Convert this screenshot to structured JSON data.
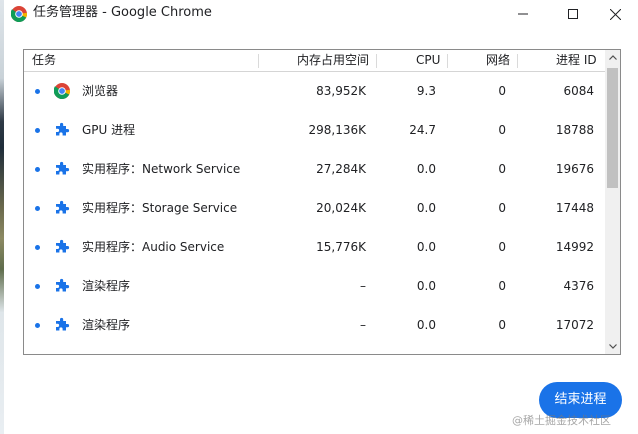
{
  "window": {
    "title": "任务管理器 - Google Chrome"
  },
  "table": {
    "headers": {
      "task": "任务",
      "memory": "内存占用空间",
      "cpu": "CPU",
      "network": "网络",
      "pid": "进程 ID"
    },
    "rows": [
      {
        "icon": "chrome-icon",
        "name": "浏览器",
        "memory": "83,952K",
        "cpu": "9.3",
        "network": "0",
        "pid": "6084"
      },
      {
        "icon": "puzzle-icon",
        "name": "GPU 进程",
        "memory": "298,136K",
        "cpu": "24.7",
        "network": "0",
        "pid": "18788"
      },
      {
        "icon": "puzzle-icon",
        "name": "实用程序：Network Service",
        "memory": "27,284K",
        "cpu": "0.0",
        "network": "0",
        "pid": "19676"
      },
      {
        "icon": "puzzle-icon",
        "name": "实用程序：Storage Service",
        "memory": "20,024K",
        "cpu": "0.0",
        "network": "0",
        "pid": "17448"
      },
      {
        "icon": "puzzle-icon",
        "name": "实用程序：Audio Service",
        "memory": "15,776K",
        "cpu": "0.0",
        "network": "0",
        "pid": "14992"
      },
      {
        "icon": "puzzle-icon",
        "name": "渲染程序",
        "memory": "–",
        "cpu": "0.0",
        "network": "0",
        "pid": "4376"
      },
      {
        "icon": "puzzle-icon",
        "name": "渲染程序",
        "memory": "–",
        "cpu": "0.0",
        "network": "0",
        "pid": "17072"
      }
    ]
  },
  "actions": {
    "end_process_label": "结束进程"
  },
  "watermark": {
    "text": "@稀土掘金技术社区"
  },
  "colors": {
    "accent": "#1a73e8",
    "border": "#8a8a8a",
    "scrollbar_thumb": "#c1c1c1"
  }
}
